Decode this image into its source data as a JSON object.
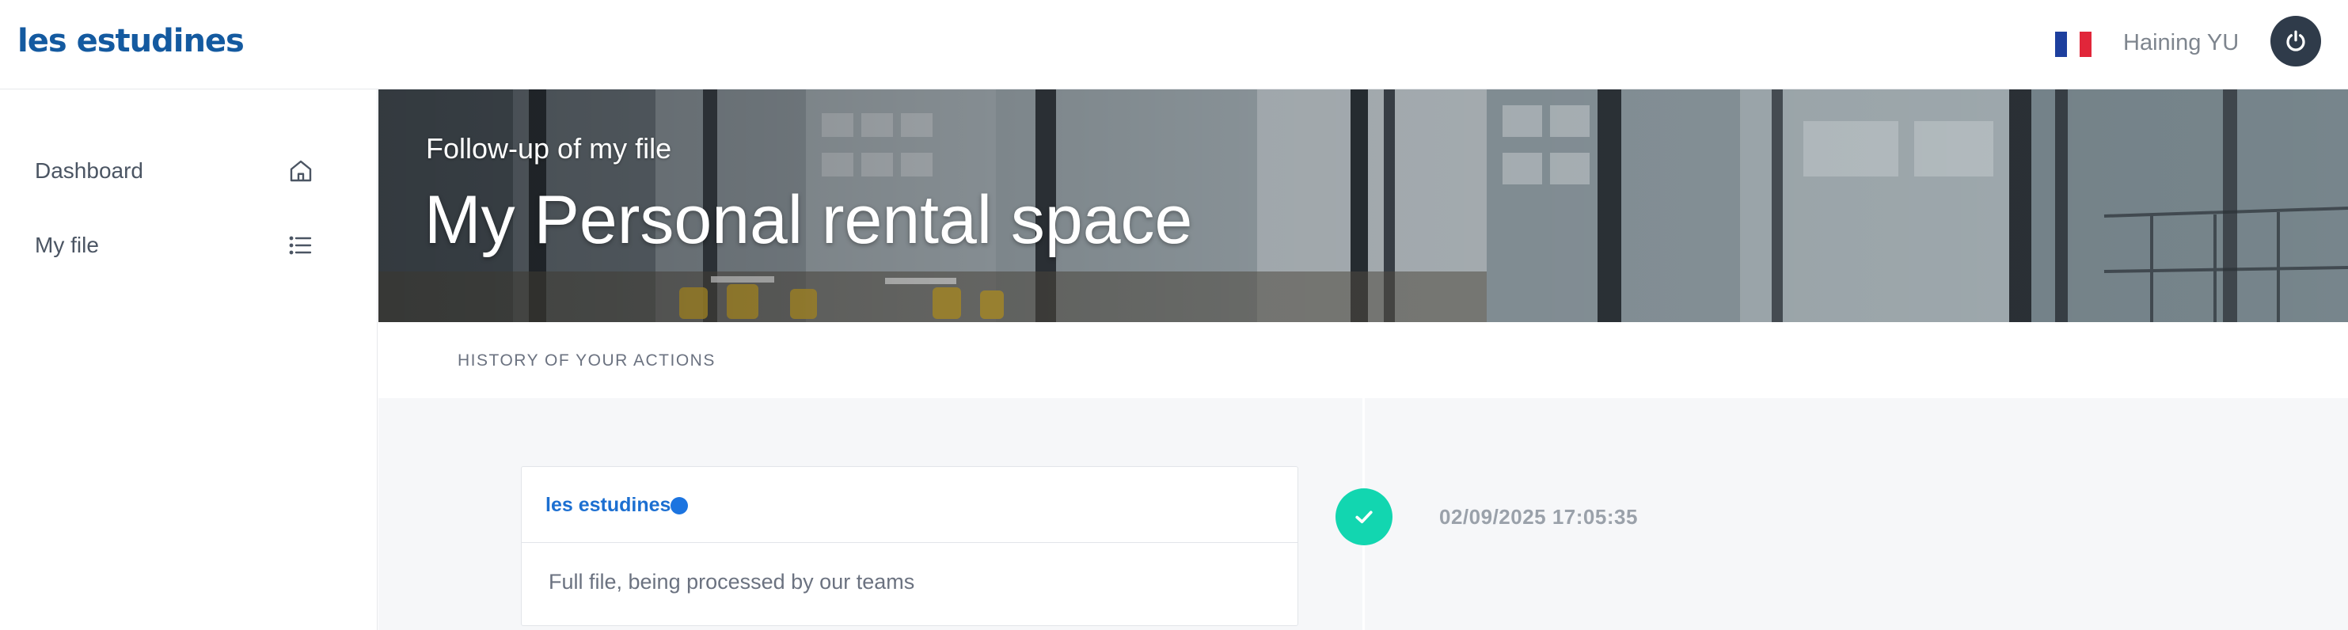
{
  "header": {
    "logo_text": "les estudines",
    "language_flag": "france-flag-icon",
    "user_name": "Haining YU",
    "logout_icon": "power-icon"
  },
  "sidebar": {
    "items": [
      {
        "label": "Dashboard",
        "icon": "home-icon"
      },
      {
        "label": "My file",
        "icon": "list-icon"
      }
    ]
  },
  "hero": {
    "subtitle": "Follow-up of my file",
    "title": "My Personal rental space"
  },
  "history": {
    "section_label": "HISTORY OF YOUR ACTIONS",
    "entries": [
      {
        "author": "les estudines",
        "message": "Full file, being processed by our teams",
        "timestamp": "02/09/2025 17:05:35",
        "status_icon": "check-icon"
      }
    ]
  },
  "colors": {
    "brand": "#145aa0",
    "link_blue": "#1c6fd1",
    "success": "#12d6b0",
    "dark_button": "#2f3b4a"
  }
}
